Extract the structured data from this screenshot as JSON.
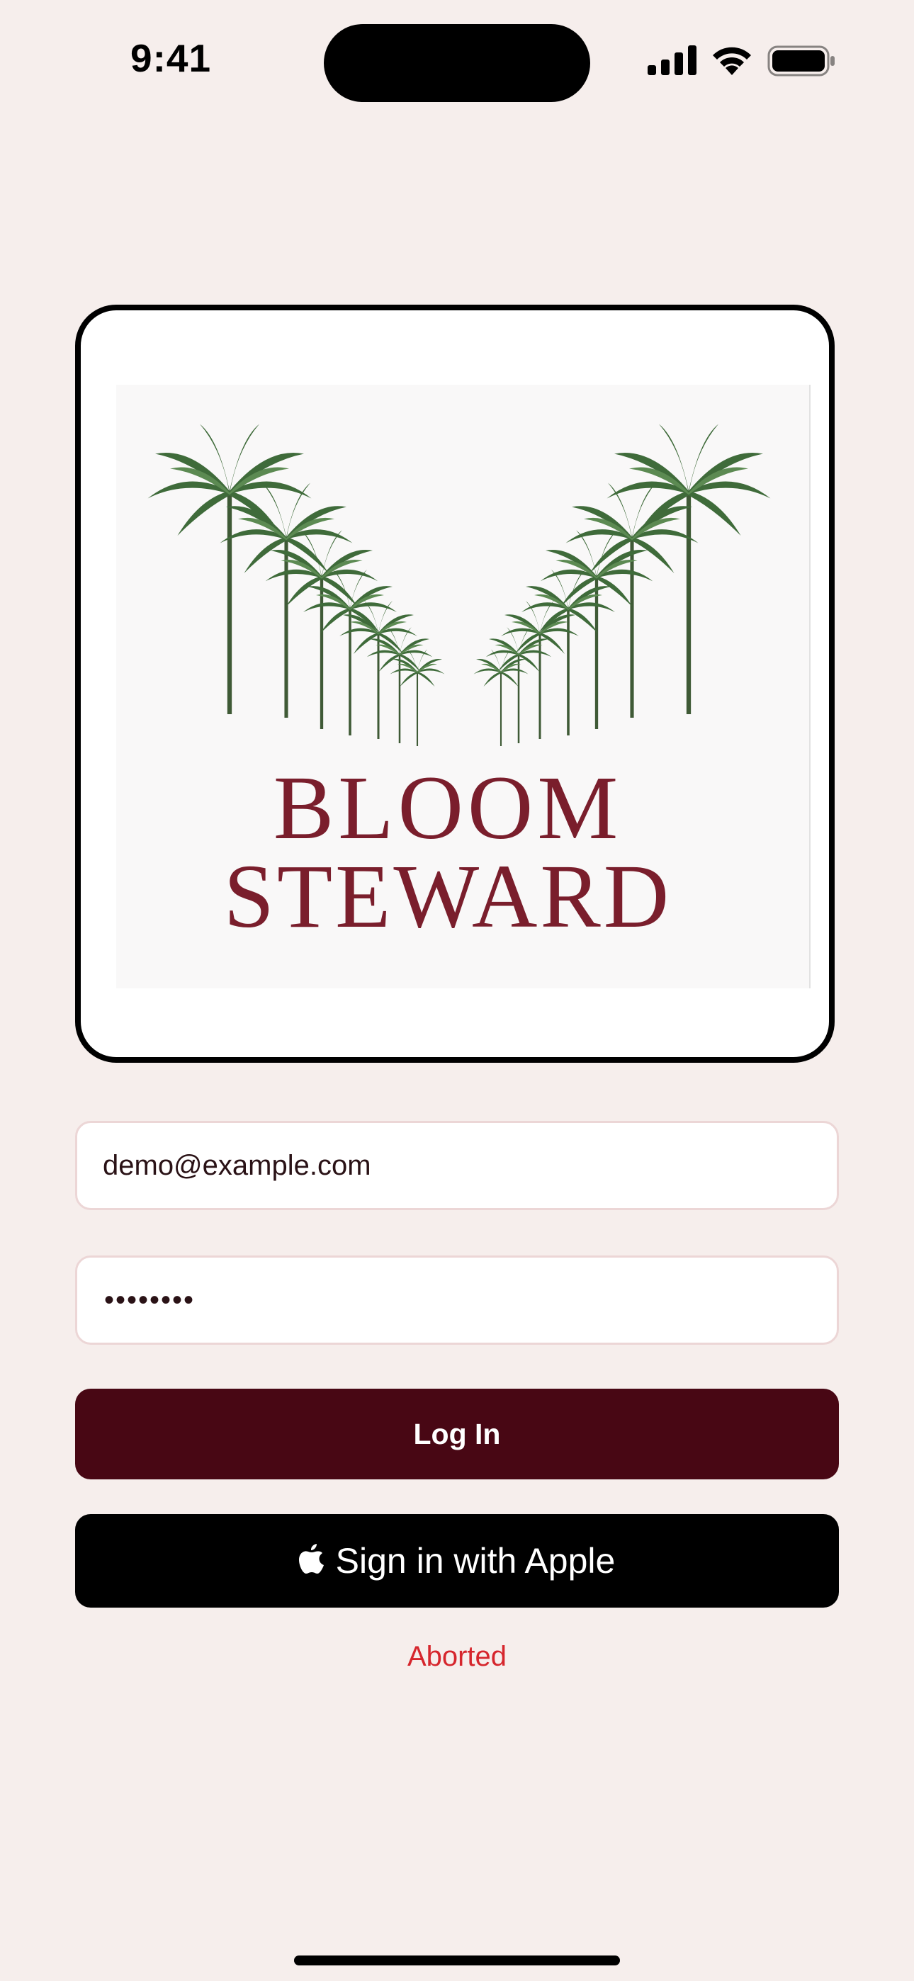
{
  "status_bar": {
    "time": "9:41",
    "icons": [
      "signal-icon",
      "wifi-icon",
      "battery-icon"
    ]
  },
  "logo": {
    "line1": "BLOOM",
    "line2": "STEWARD",
    "text_color": "#7a1e2c",
    "palm_color": "#3f6b3a"
  },
  "form": {
    "email_value": "demo@example.com",
    "password_mask": "••••••••"
  },
  "buttons": {
    "login_label": "Log In",
    "apple_label": "Sign in with Apple"
  },
  "status": {
    "error_message": "Aborted"
  },
  "colors": {
    "background": "#f6eeec",
    "primary": "#480714",
    "apple": "#000000",
    "error": "#d6262d"
  }
}
